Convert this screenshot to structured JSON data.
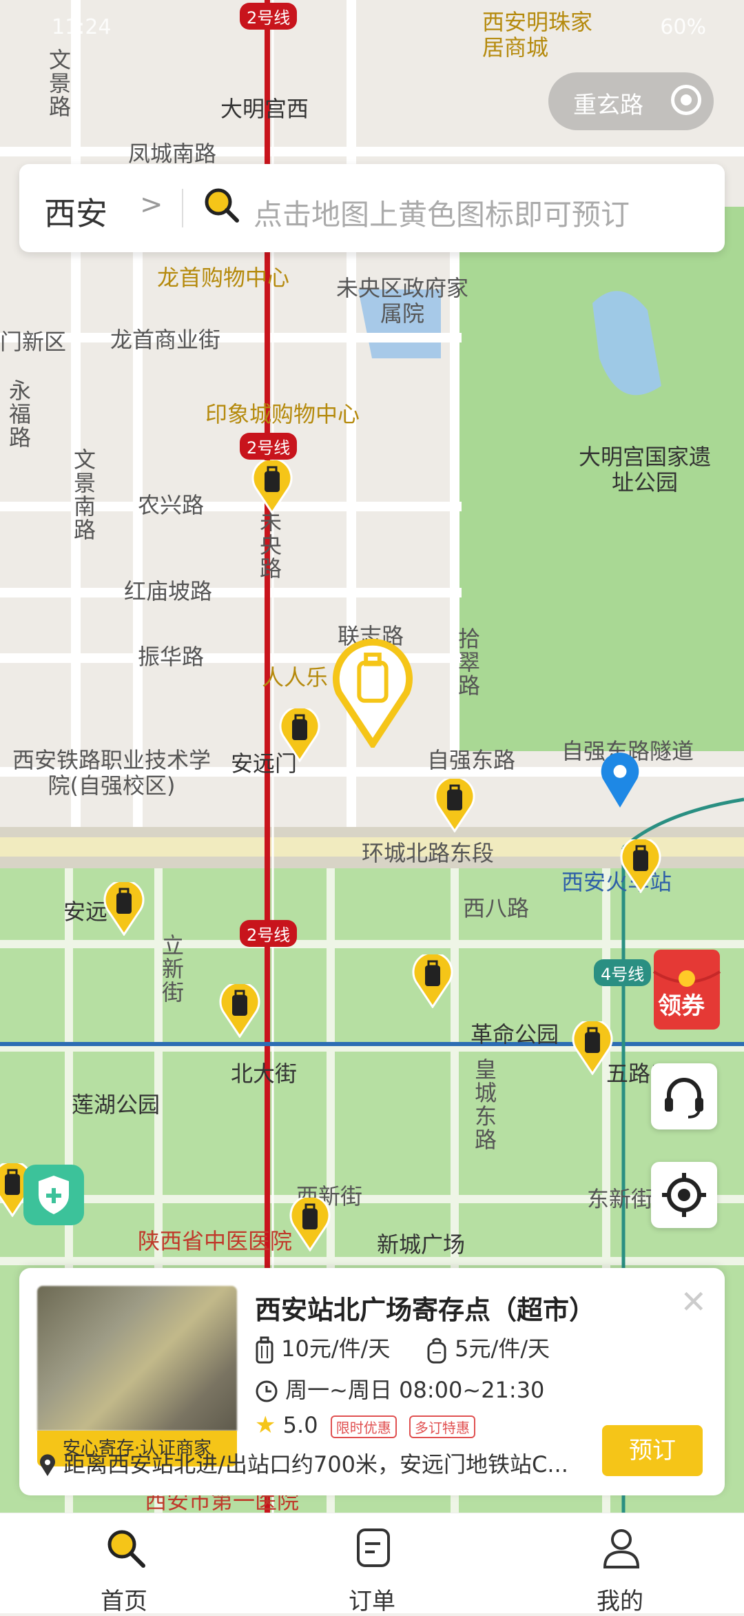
{
  "status_bar": {
    "time": "11:24",
    "battery": "60%"
  },
  "search": {
    "city": "西安",
    "city_chevron": ">",
    "placeholder": "点击地图上黄色图标即可预订"
  },
  "top_right_pill": {
    "label": "重玄路"
  },
  "top_poi": "西安明珠家居商城",
  "map_labels": {
    "metro_stations": [
      "大明宫西",
      "安远门",
      "北大街",
      "五路口",
      "西安火车站"
    ],
    "line_badges": [
      "2号线",
      "2号线",
      "2号线",
      "4号线"
    ],
    "roads": [
      "凤城南路",
      "龙首商业街",
      "农兴路",
      "红庙坡路",
      "振华路",
      "联志路",
      "自强东路",
      "自强东路隧道",
      "环城北路东段",
      "西八路",
      "西新街",
      "东新街"
    ],
    "vertical_roads": [
      "文景路",
      "永福路",
      "文景南路",
      "未央路",
      "拾翠路",
      "立新街",
      "皇城东路"
    ],
    "pois": [
      "龙首购物中心",
      "印象城购物中心",
      "人人乐",
      "新城广场",
      "革命公园",
      "莲湖公园",
      "大明宫国家遗址公园",
      "未央区政府家属院",
      "西安铁路职业技术学院(自强校区)",
      "陕西省中医医院",
      "西安市第一医院",
      "门新区",
      "安远"
    ]
  },
  "coupon": {
    "label": "领券"
  },
  "card": {
    "title": "西安站北广场寄存点（超市）",
    "badge": "安心寄存·认证商家",
    "large_price": "10元/件/天",
    "small_price": "5元/件/天",
    "hours": "周一~周日 08:00~21:30",
    "rating": "5.0",
    "tags": [
      "限时优惠",
      "多订特惠"
    ],
    "address": "距离西安站北进/出站口约700米，安远门地铁站C...",
    "book_label": "预订",
    "close_label": "✕"
  },
  "tabs": [
    {
      "label": "首页",
      "icon": "search-icon",
      "active": true
    },
    {
      "label": "订单",
      "icon": "order-icon",
      "active": false
    },
    {
      "label": "我的",
      "icon": "user-icon",
      "active": false
    }
  ],
  "colors": {
    "accent": "#f5c518",
    "metro_line_2": "#c8141c",
    "metro_line_4": "#2a8f82",
    "park": "#a8d89a"
  }
}
